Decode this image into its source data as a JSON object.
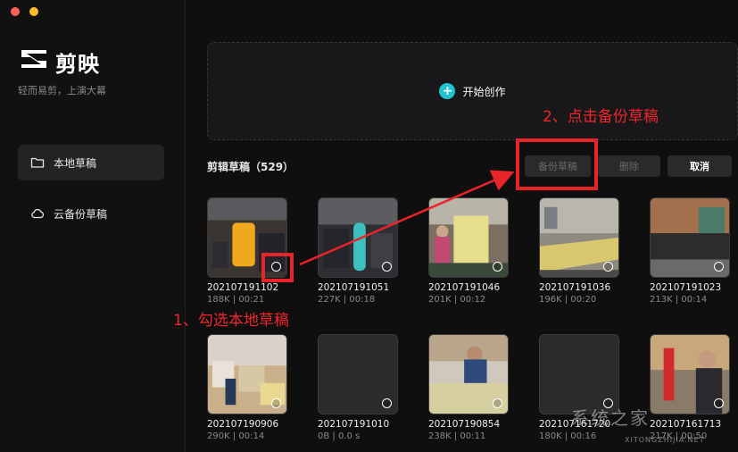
{
  "app": {
    "name": "剪映",
    "slogan": "轻而易剪，上演大幕"
  },
  "sidebar": {
    "items": [
      {
        "label": "本地草稿",
        "icon": "folder-icon",
        "active": true
      },
      {
        "label": "云备份草稿",
        "icon": "cloud-icon",
        "active": false
      }
    ]
  },
  "create": {
    "label": "开始创作",
    "icon": "plus-icon"
  },
  "drafts": {
    "title": "剪辑草稿（529）",
    "actions": {
      "backup": "备份草稿",
      "delete": "删除",
      "cancel": "取消"
    },
    "items": [
      {
        "name": "202107191102",
        "meta": "188K | 00:21"
      },
      {
        "name": "202107191051",
        "meta": "227K | 00:18"
      },
      {
        "name": "202107191046",
        "meta": "201K | 00:12"
      },
      {
        "name": "202107191036",
        "meta": "196K | 00:20"
      },
      {
        "name": "202107191023",
        "meta": "213K | 00:14"
      },
      {
        "name": "202107190906",
        "meta": "290K | 00:14"
      },
      {
        "name": "202107191010",
        "meta": "0B | 0.0 s"
      },
      {
        "name": "202107190854",
        "meta": "238K | 00:11"
      },
      {
        "name": "202107161720",
        "meta": "180K | 00:16"
      },
      {
        "name": "202107161713",
        "meta": "217K | 00:50"
      }
    ]
  },
  "annotations": {
    "step1": "1、勾选本地草稿",
    "step2": "2、点击备份草稿",
    "color": "#e8232a"
  },
  "watermark": {
    "text": "系统之家",
    "sub": "XITONGZHIJIA.NET"
  }
}
